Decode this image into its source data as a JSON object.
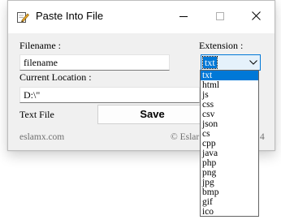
{
  "window": {
    "title": "Paste Into File",
    "icon": "pencil-document-icon",
    "controls": {
      "minimize": "minimize-icon",
      "maximize": "maximize-icon",
      "close": "close-icon"
    }
  },
  "form": {
    "filename_label": "Filename :",
    "filename_value": "filename",
    "extension_label": "Extension :",
    "extension_selected": "txt",
    "current_location_label": "Current Location :",
    "current_location_value": "D:\\\"",
    "text_file_label": "Text File",
    "save_label": "Save"
  },
  "footer": {
    "left_text": "eslamx.com",
    "right_text_prefix": "© Eslar",
    "right_text_suffix": "4"
  },
  "dropdown": {
    "options": [
      "txt",
      "html",
      "js",
      "css",
      "csv",
      "json",
      "cs",
      "cpp",
      "java",
      "php",
      "png",
      "jpg",
      "bmp",
      "gif",
      "ico"
    ],
    "selected_index": 0
  },
  "colors": {
    "accent": "#0078d7",
    "window_bg": "#f0f0f0",
    "titlebar_bg": "#ffffff"
  }
}
